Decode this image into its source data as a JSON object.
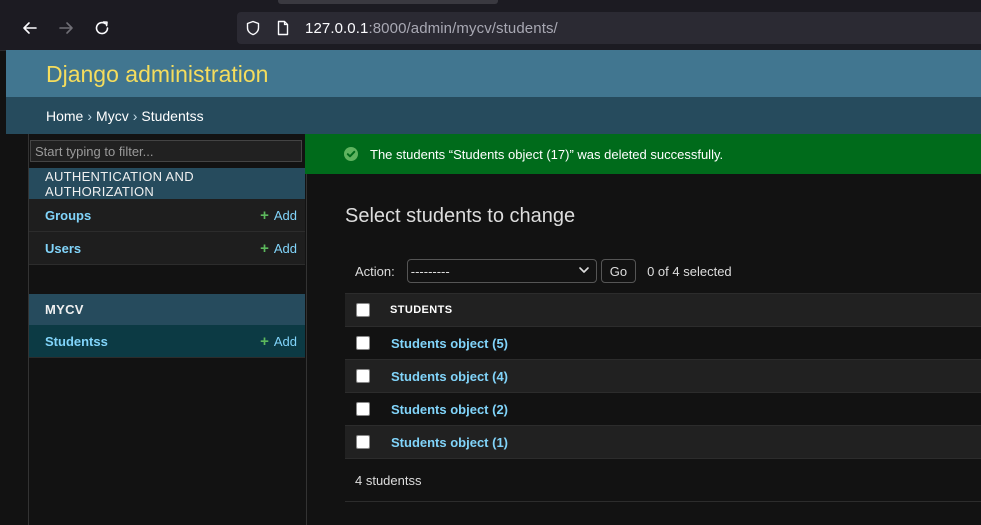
{
  "browser": {
    "url_host": "127.0.0.1",
    "url_rest": ":8000/admin/mycv/students/"
  },
  "header": {
    "branding": "Django administration"
  },
  "breadcrumbs": {
    "home": "Home",
    "sep": "›",
    "app": "Mycv",
    "current": "Studentss"
  },
  "sidebar": {
    "filter_placeholder": "Start typing to filter...",
    "modules": [
      {
        "caption": "AUTHENTICATION AND AUTHORIZATION",
        "models": [
          {
            "name": "Groups",
            "add": "Add"
          },
          {
            "name": "Users",
            "add": "Add"
          }
        ]
      },
      {
        "caption": "MYCV",
        "models": [
          {
            "name": "Studentss",
            "add": "Add"
          }
        ]
      }
    ],
    "add_symbol": "+"
  },
  "message": {
    "text": "The students “Students object (17)” was deleted successfully."
  },
  "main": {
    "title": "Select students to change",
    "action_label": "Action:",
    "action_selected": "---------",
    "go_label": "Go",
    "counter": "0 of 4 selected",
    "column_header": "STUDENTS",
    "rows": [
      "Students object (5)",
      "Students object (4)",
      "Students object (2)",
      "Students object (1)"
    ],
    "paginator": "4 studentss"
  },
  "colors": {
    "header_bg": "#417690",
    "branding": "#f5dd5d",
    "breadcrumbs_bg": "#264b5d",
    "success_bg": "#006b1b",
    "link": "#81d4fa",
    "add_plus": "#5cb85c"
  }
}
